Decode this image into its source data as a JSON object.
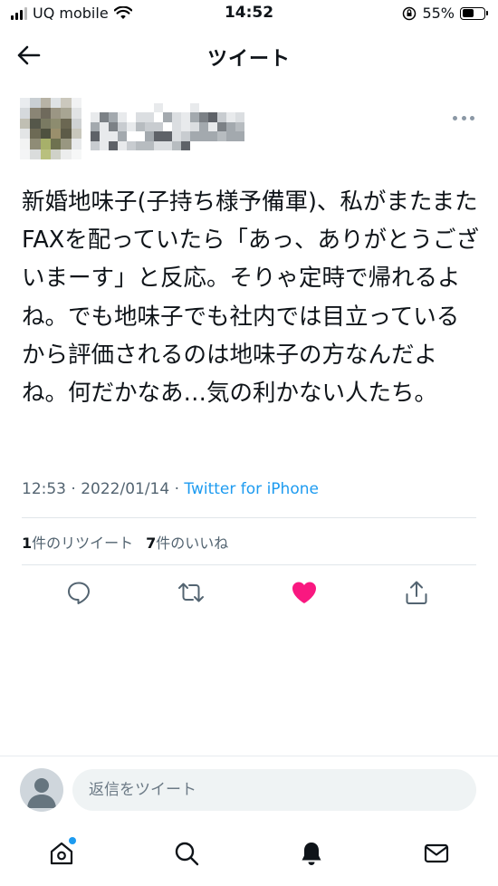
{
  "status_bar": {
    "carrier": "UQ mobile",
    "time": "14:52",
    "battery": "55%",
    "battery_level": 0.55
  },
  "header": {
    "title": "ツイート"
  },
  "tweet": {
    "text": "新婚地味子(子持ち様予備軍)、私がまたまたFAXを配っていたら「あっ、ありがとうございまーす」と反応。そりゃ定時で帰れるよね。でも地味子でも社内では目立っているから評価されるのは地味子の方なんだよね。何だかなあ…気の利かない人たち。",
    "timestamp": "12:53 · 2022/01/14",
    "separator": " · ",
    "source": "Twitter for iPhone",
    "retweet_count": "1",
    "retweet_label": "件のリツイート",
    "like_count": "7",
    "like_label": "件のいいね"
  },
  "reply": {
    "placeholder": "返信をツイート"
  },
  "colors": {
    "accent": "#1d9bf0",
    "like": "#f91880",
    "muted": "#536471"
  },
  "icons": {
    "back": "arrow-left-icon",
    "more": "more-horizontal-icon",
    "reply": "comment-icon",
    "retweet": "retweet-icon",
    "like": "heart-filled-icon",
    "share": "share-icon",
    "home": "home-icon",
    "search": "search-icon",
    "notifications": "bell-icon",
    "messages": "mail-icon"
  }
}
